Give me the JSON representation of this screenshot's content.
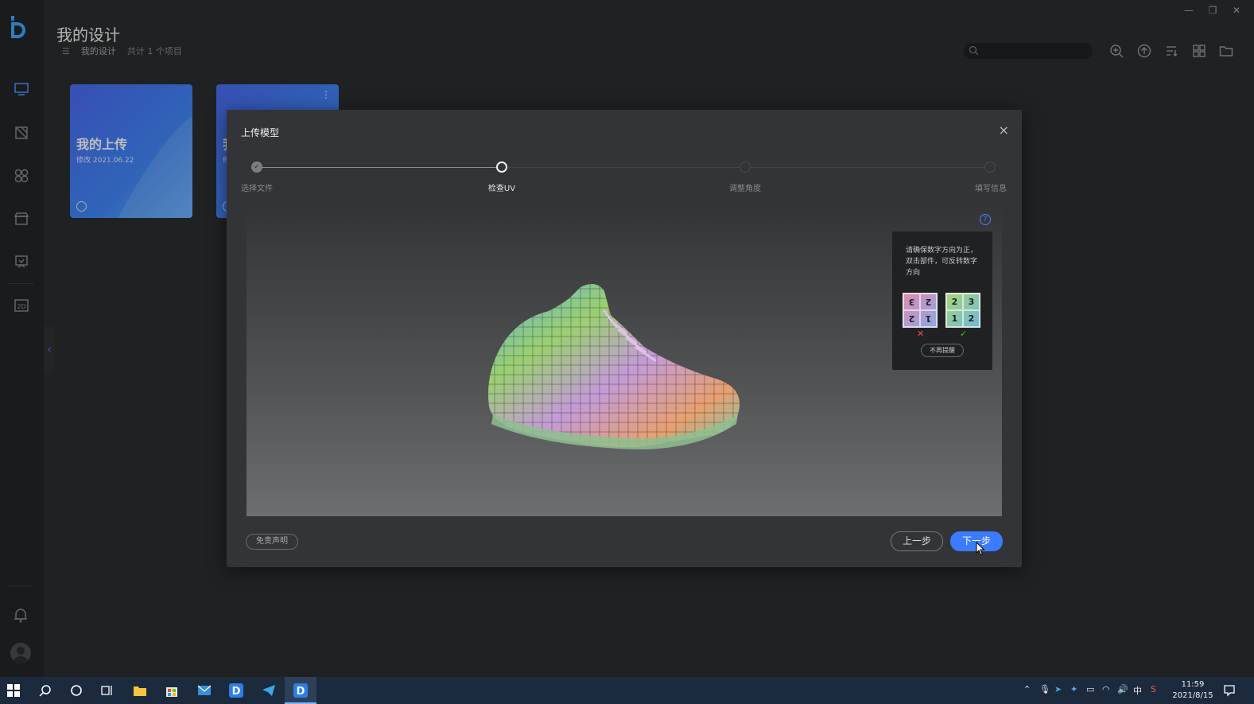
{
  "app": {
    "page_title": "我的设计",
    "breadcrumb": {
      "current": "我的设计",
      "count": "共计 1 个项目"
    }
  },
  "window_controls": {
    "minimize": "—",
    "restore": "❐",
    "close": "✕"
  },
  "toolbar": {
    "icons": [
      "zoom-in-icon",
      "upload-icon",
      "sort-icon",
      "grid-view-icon",
      "folder-icon"
    ]
  },
  "sidebar": {
    "items": [
      "monitor-icon",
      "design-icon",
      "pattern-icon",
      "store-icon",
      "display-icon",
      "2d-icon"
    ],
    "collapse": "‹"
  },
  "cards": [
    {
      "title": "我的上传",
      "date": "修改 2021.06.22"
    },
    {
      "title": "我",
      "date": "修",
      "more": "⋮"
    }
  ],
  "modal": {
    "title": "上传模型",
    "close": "×",
    "steps": [
      {
        "label": "选择文件",
        "state": "done"
      },
      {
        "label": "检查UV",
        "state": "active"
      },
      {
        "label": "调整角度",
        "state": "pending"
      },
      {
        "label": "填写信息",
        "state": "pending"
      }
    ],
    "help": "?",
    "tip": {
      "text": "请确保数字方向为正，双击部件，可反转数字方向",
      "bad_tile": [
        "3",
        "2",
        "2",
        "1"
      ],
      "good_tile": [
        "2",
        "3",
        "1",
        "2"
      ],
      "bad_mark": "✕",
      "good_mark": "✓",
      "dismiss": "不再提醒"
    },
    "disclaimer": "免责声明",
    "prev": "上一步",
    "next": "下一步"
  },
  "taskbar": {
    "tray_lang": "中",
    "time": "11:59",
    "date": "2021/8/15"
  },
  "colors": {
    "accent": "#3b7bff",
    "card_gradient_start": "#4a6af0",
    "card_gradient_end": "#5aa8ff",
    "background": "#2b2c2e"
  }
}
